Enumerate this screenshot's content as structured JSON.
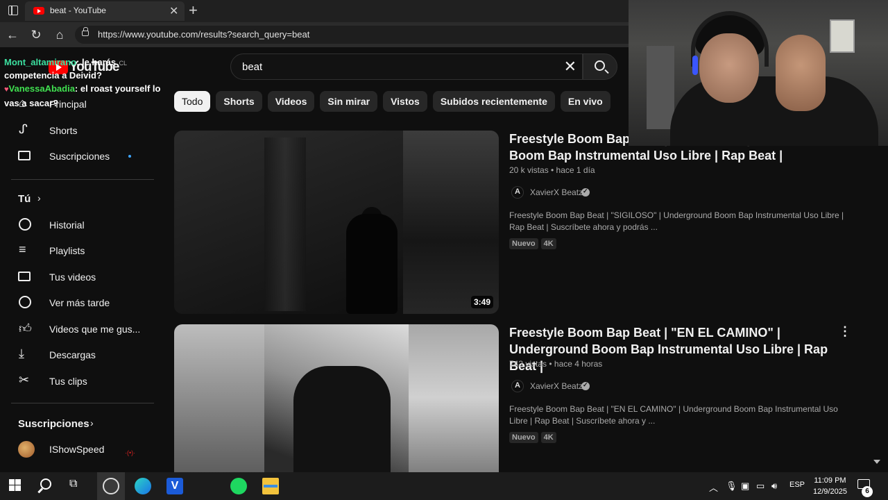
{
  "browser": {
    "tab_title": "beat - YouTube",
    "tab_close": "✕",
    "new_tab": "+",
    "url": "https://www.youtube.com/results?search_query=beat"
  },
  "header": {
    "logo_text": "YouTube",
    "logo_country": "CL",
    "search_value": "beat",
    "search_clear": "✕"
  },
  "chips": [
    "Todo",
    "Shorts",
    "Videos",
    "Sin mirar",
    "Vistos",
    "Subidos recientemente",
    "En vivo"
  ],
  "sidebar": {
    "main": [
      {
        "label": "Principal",
        "icon": "home-icon"
      },
      {
        "label": "Shorts",
        "icon": "shorts-icon"
      },
      {
        "label": "Suscripciones",
        "icon": "subscriptions-icon",
        "dot": true
      }
    ],
    "you_header": "Tú",
    "you": [
      {
        "label": "Historial",
        "icon": "history-icon"
      },
      {
        "label": "Playlists",
        "icon": "playlists-icon"
      },
      {
        "label": "Tus videos",
        "icon": "your-videos-icon"
      },
      {
        "label": "Ver más tarde",
        "icon": "watch-later-icon"
      },
      {
        "label": "Videos que me gus...",
        "icon": "liked-videos-icon"
      },
      {
        "label": "Descargas",
        "icon": "downloads-icon"
      },
      {
        "label": "Tus clips",
        "icon": "clips-icon"
      }
    ],
    "subs_header": "Suscripciones",
    "subs": [
      {
        "label": "IShowSpeed",
        "icon": "channel-avatar",
        "live": true
      }
    ]
  },
  "chat": [
    {
      "user": "Mont_altamirano",
      "text": "le harás competencia a Deivid?"
    },
    {
      "user": "VanessaAbadia",
      "text": "el roast yourself lo vas a sacar?"
    }
  ],
  "videos": [
    {
      "title": "Freestyle Boom Bap Beat | \"SIGILOSO\" | Underground Boom Bap Instrumental Uso Libre | Rap Beat |",
      "meta": "20 k vistas • hace 1 día",
      "channel": "XavierX Beatz",
      "description": "Freestyle Boom Bap Beat | \"SIGILOSO\" | Underground Boom Bap Instrumental Uso Libre | Rap Beat | Suscríbete ahora y podrás ...",
      "badges": [
        "Nuevo",
        "4K"
      ],
      "duration": "3:49"
    },
    {
      "title": "Freestyle Boom Bap Beat | \"EN EL CAMINO\" | Underground Boom Bap Instrumental Uso Libre | Rap Beat |",
      "meta": "743 vistas • hace 4 horas",
      "channel": "XavierX Beatz",
      "description": "Freestyle Boom Bap Beat | \"EN EL CAMINO\" | Underground Boom Bap Instrumental Uso Libre | Rap Beat | Suscríbete ahora y ...",
      "badges": [
        "Nuevo",
        "4K"
      ],
      "more": "⋮"
    }
  ],
  "taskbar": {
    "lang": "ESP",
    "time": "11:09 PM",
    "date": "12/9/2025",
    "notifications": "6",
    "v_label": "V"
  },
  "colors": {
    "accent": "#ff0000",
    "background": "#0f0f0f",
    "chip_bg": "#272727",
    "link_blue": "#3ea6ff"
  }
}
